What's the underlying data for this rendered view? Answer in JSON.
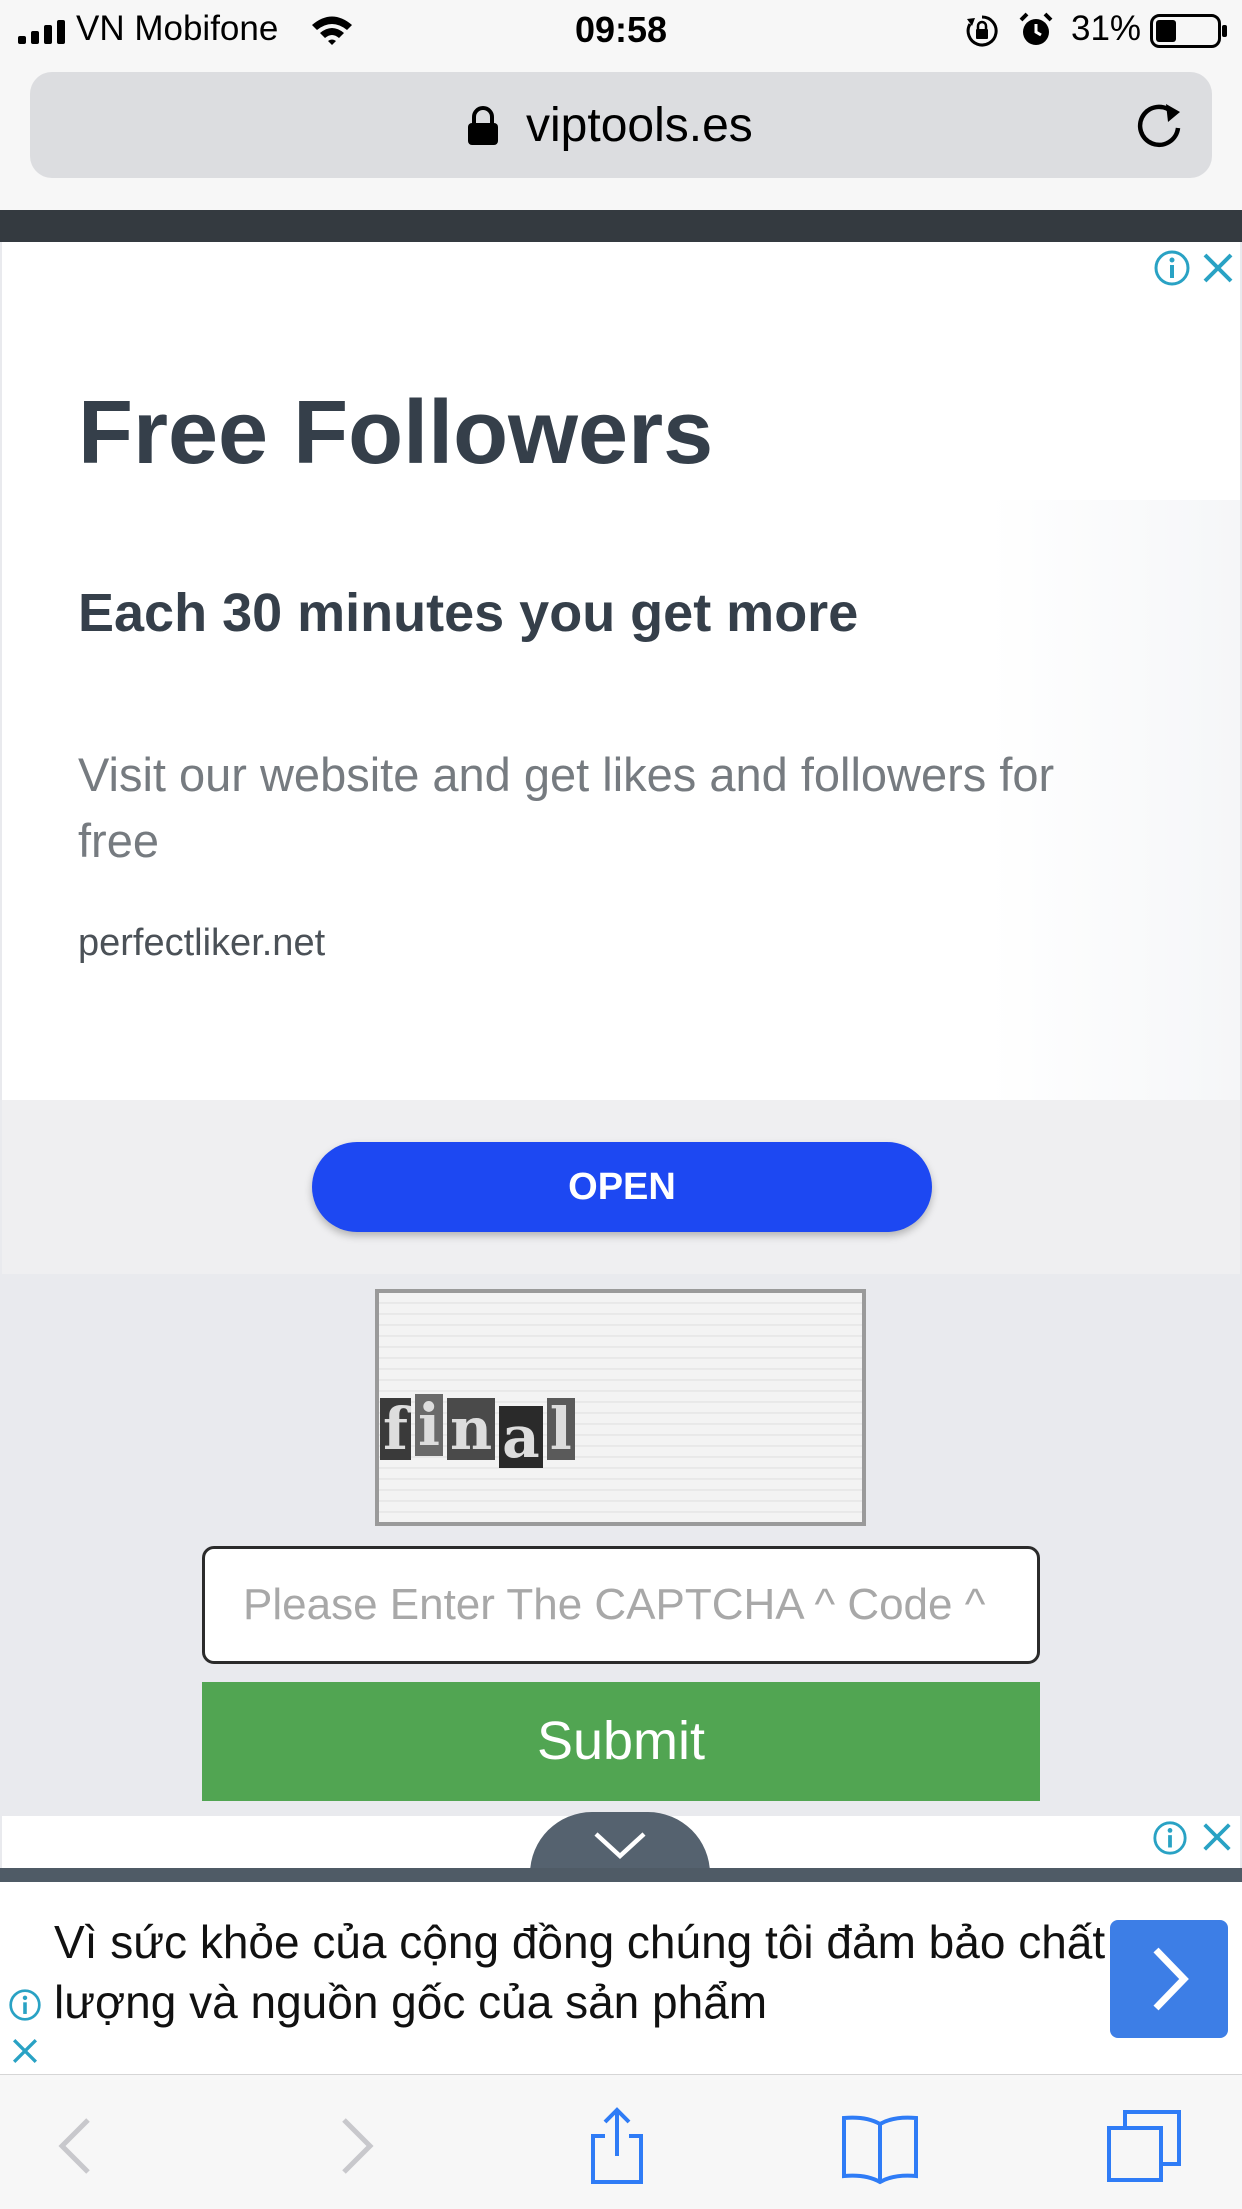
{
  "status_bar": {
    "carrier": "VN Mobifone",
    "time": "09:58",
    "battery": "31%",
    "icons": [
      "signal-icon",
      "wifi-icon",
      "orientation-lock-icon",
      "alarm-icon",
      "battery-icon"
    ]
  },
  "browser": {
    "url": "viptools.es",
    "icons": [
      "lock-icon",
      "reload-icon"
    ]
  },
  "ad_top": {
    "headline": "Free Followers",
    "subheadline": "Each 30 minutes you get more",
    "body": "Visit our website and get likes and followers for free",
    "domain": "perfectliker.net",
    "button_label": "OPEN",
    "colors": {
      "button": "#1d48f2",
      "heading": "#353f4a"
    }
  },
  "captcha": {
    "letters": [
      "f",
      "i",
      "n",
      "a",
      "l"
    ],
    "input_placeholder": "Please Enter The CAPTCHA ^ Code ^",
    "input_value": "",
    "submit_label": "Submit",
    "colors": {
      "submit": "#51a552"
    }
  },
  "ad_bottom": {
    "text": "Vì sức khỏe của cộng đồng chúng tôi đảm bảo chất lượng và nguồn gốc của sản phẩm",
    "colors": {
      "arrow_button": "#3d7ee6"
    }
  },
  "toolbar": {
    "icons": [
      "back-icon",
      "forward-icon",
      "share-icon",
      "bookmarks-icon",
      "tabs-icon"
    ]
  }
}
